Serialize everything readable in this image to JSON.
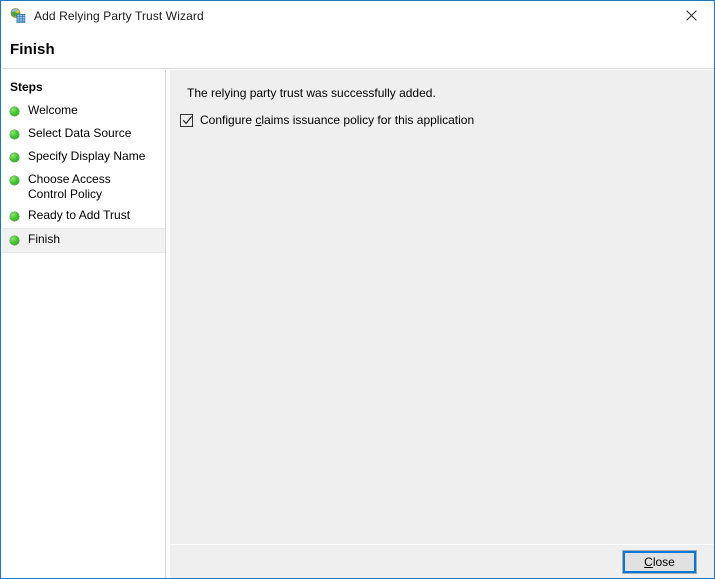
{
  "window": {
    "title": "Add Relying Party Trust Wizard",
    "icon": "adfs-globe-server-icon",
    "close_icon": "close-icon",
    "accent_color": "#0078d7",
    "border_color": "#1b79c4"
  },
  "header": {
    "heading": "Finish"
  },
  "sidebar": {
    "title": "Steps",
    "bullet_color": "#3fc62c",
    "items": [
      {
        "label": "Welcome",
        "state": "complete"
      },
      {
        "label": "Select Data Source",
        "state": "complete"
      },
      {
        "label": "Specify Display Name",
        "state": "complete"
      },
      {
        "label": "Choose Access Control Policy",
        "state": "complete"
      },
      {
        "label": "Ready to Add Trust",
        "state": "complete"
      },
      {
        "label": "Finish",
        "state": "current"
      }
    ]
  },
  "main": {
    "success_message": "The relying party trust was successfully added.",
    "checkbox": {
      "checked": true,
      "label_prefix": "Configure ",
      "label_accel": "c",
      "label_suffix": "laims issuance policy for this application",
      "full_label": "Configure claims issuance policy for this application"
    }
  },
  "footer": {
    "close_button": {
      "label_accel": "C",
      "label_suffix": "lose",
      "full_label": "Close",
      "focused": true
    }
  }
}
